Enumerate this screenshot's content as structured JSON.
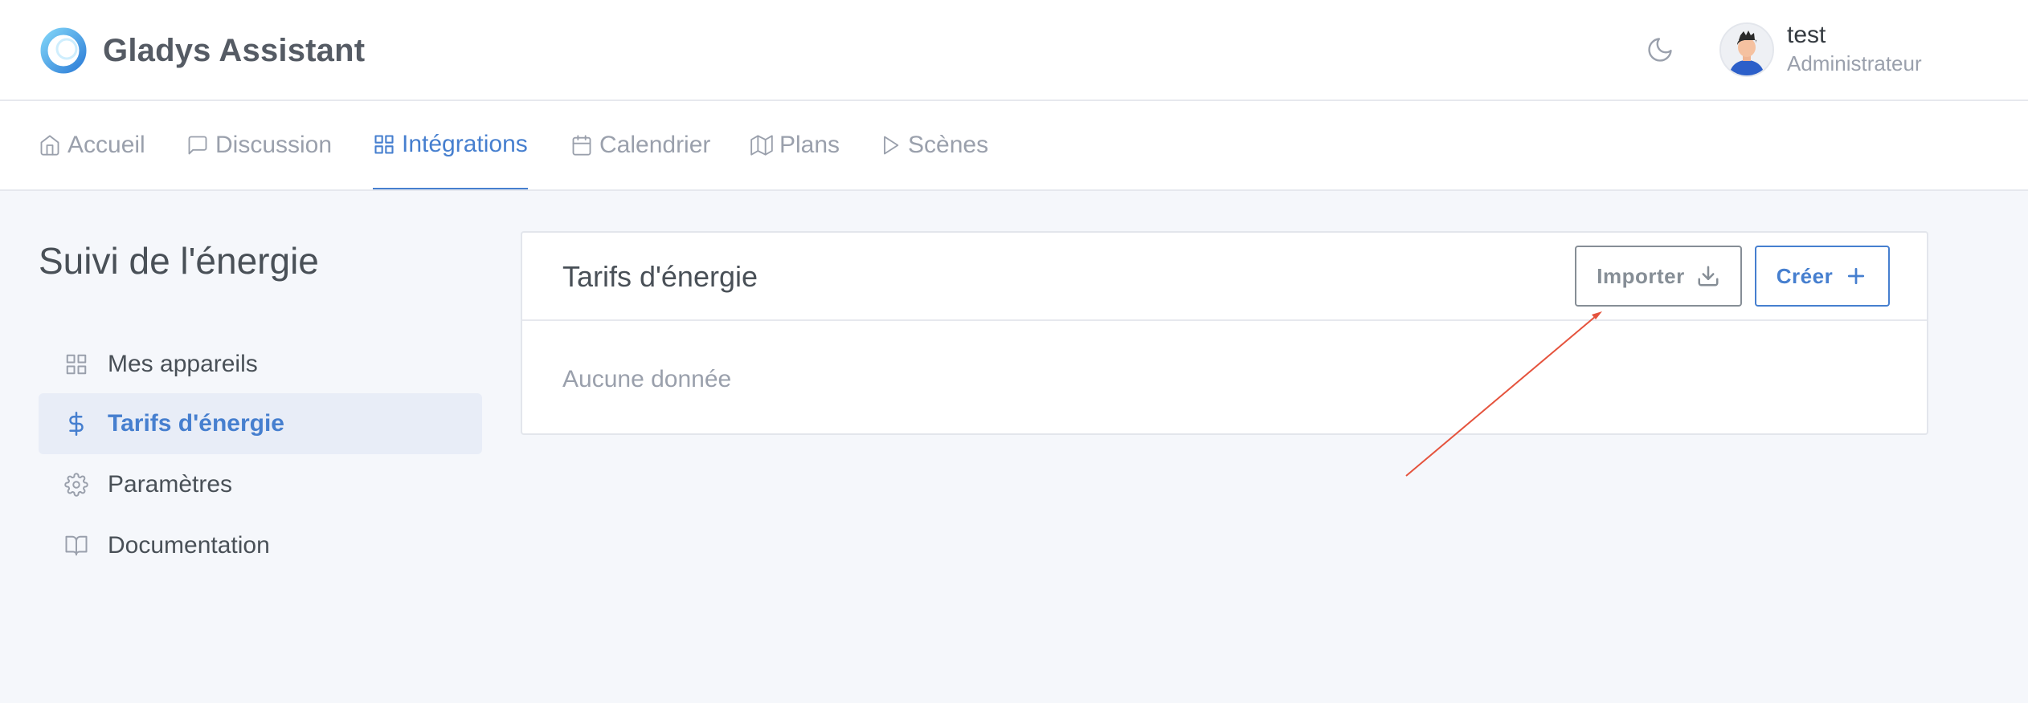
{
  "brand": {
    "name": "Gladys Assistant",
    "logo_icon": "gladys-logo-icon"
  },
  "header": {
    "theme_icon": "moon-icon"
  },
  "user": {
    "name": "test",
    "role": "Administrateur"
  },
  "nav": {
    "tabs": [
      {
        "label": "Accueil",
        "icon": "home-icon"
      },
      {
        "label": "Discussion",
        "icon": "message-square-icon"
      },
      {
        "label": "Intégrations",
        "icon": "grid-icon",
        "active": true
      },
      {
        "label": "Calendrier",
        "icon": "calendar-icon"
      },
      {
        "label": "Plans",
        "icon": "map-icon"
      },
      {
        "label": "Scènes",
        "icon": "play-icon"
      }
    ]
  },
  "sidebar": {
    "title": "Suivi de l'énergie",
    "items": [
      {
        "label": "Mes appareils",
        "icon": "grid-icon"
      },
      {
        "label": "Tarifs d'énergie",
        "icon": "dollar-icon",
        "active": true
      },
      {
        "label": "Paramètres",
        "icon": "gear-icon"
      },
      {
        "label": "Documentation",
        "icon": "book-icon"
      }
    ]
  },
  "main": {
    "card_title": "Tarifs d'énergie",
    "import_label": "Importer",
    "create_label": "Créer",
    "empty_text": "Aucune donnée"
  },
  "colors": {
    "accent": "#467fcf",
    "annotation_arrow": "#e5533d",
    "background": "#f5f7fb"
  }
}
